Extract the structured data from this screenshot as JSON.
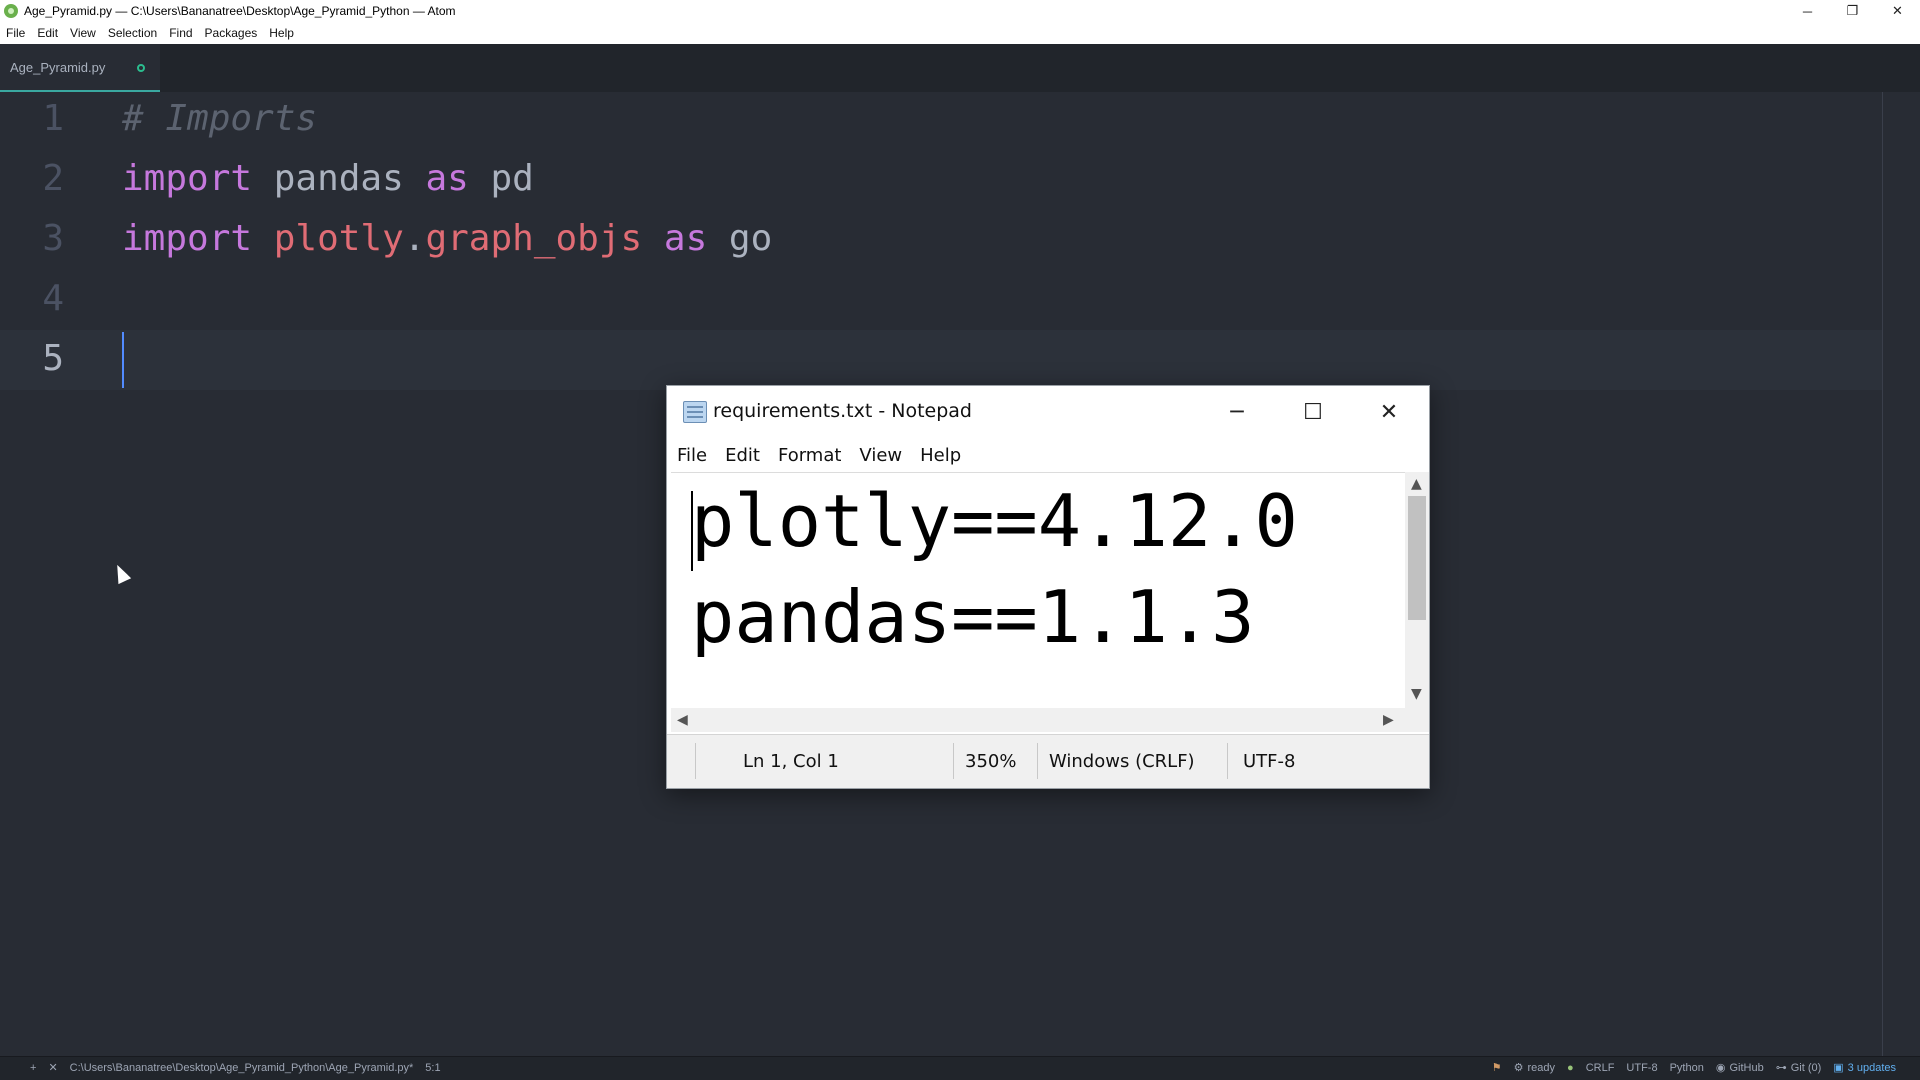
{
  "atom": {
    "window_title": "Age_Pyramid.py — C:\\Users\\Bananatree\\Desktop\\Age_Pyramid_Python — Atom",
    "window_controls": {
      "minimize": "─",
      "restore": "❐",
      "close": "✕"
    },
    "menu": [
      "File",
      "Edit",
      "View",
      "Selection",
      "Find",
      "Packages",
      "Help"
    ],
    "tab": {
      "label": "Age_Pyramid.py",
      "modified": true
    },
    "editor": {
      "line_numbers": [
        "1",
        "2",
        "3",
        "4",
        "5"
      ],
      "lines": [
        [
          {
            "t": "# Imports",
            "c": "comment"
          }
        ],
        [
          {
            "t": "import",
            "c": "keyword"
          },
          {
            "t": " pandas ",
            "c": "plain"
          },
          {
            "t": "as",
            "c": "keyword"
          },
          {
            "t": " pd",
            "c": "plain"
          }
        ],
        [
          {
            "t": "import",
            "c": "keyword"
          },
          {
            "t": " plotly",
            "c": "module"
          },
          {
            "t": ".",
            "c": "plain"
          },
          {
            "t": "graph_objs",
            "c": "module"
          },
          {
            "t": " ",
            "c": "plain"
          },
          {
            "t": "as",
            "c": "keyword"
          },
          {
            "t": " go",
            "c": "plain"
          }
        ],
        [],
        []
      ]
    },
    "status": {
      "add": "+",
      "close": "✕",
      "file_path": "C:\\Users\\Bananatree\\Desktop\\Age_Pyramid_Python\\Age_Pyramid.py*",
      "cursor_position": "5:1",
      "ready": "ready",
      "line_ending": "CRLF",
      "encoding": "UTF-8",
      "grammar": "Python",
      "github": "GitHub",
      "git": "Git (0)",
      "updates": "3 updates"
    }
  },
  "notepad": {
    "title": "requirements.txt - Notepad",
    "controls": {
      "minimize": "─",
      "maximize": "☐",
      "close": "✕"
    },
    "menu": [
      "File",
      "Edit",
      "Format",
      "View",
      "Help"
    ],
    "lines": [
      "plotly==4.12.0",
      "pandas==1.1.3"
    ],
    "scroll_arrows": {
      "up": "▲",
      "down": "▼",
      "left": "◀",
      "right": "▶"
    },
    "status": {
      "position": "Ln 1, Col 1",
      "zoom": "350%",
      "line_ending": "Windows (CRLF)",
      "encoding": "UTF-8"
    }
  }
}
